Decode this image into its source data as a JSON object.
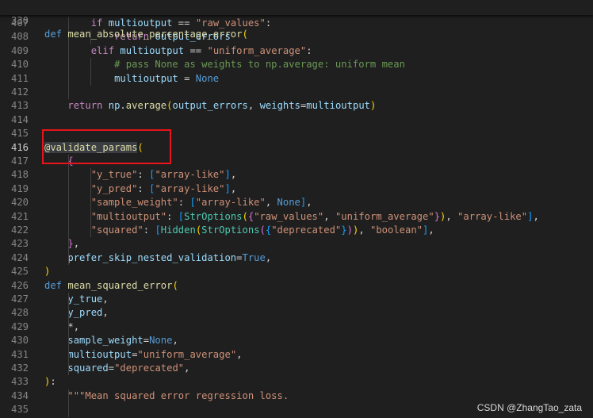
{
  "editor": {
    "sticky": {
      "line_number": "330",
      "tokens": [
        {
          "t": "def",
          "c": "kw"
        },
        {
          "t": " ",
          "c": ""
        },
        {
          "t": "mean_absolute_percentage_error",
          "c": "fn"
        },
        {
          "t": "(",
          "c": "b1"
        }
      ]
    },
    "lines": [
      {
        "n": "407",
        "tokens": [
          {
            "t": "        ",
            "c": ""
          },
          {
            "t": "if",
            "c": "ctl"
          },
          {
            "t": " ",
            "c": ""
          },
          {
            "t": "multioutput",
            "c": "var"
          },
          {
            "t": " == ",
            "c": "plain"
          },
          {
            "t": "\"raw_values\"",
            "c": "str"
          },
          {
            "t": ":",
            "c": "plain"
          }
        ]
      },
      {
        "n": "408",
        "tokens": [
          {
            "t": "            ",
            "c": ""
          },
          {
            "t": "return",
            "c": "ctl"
          },
          {
            "t": " ",
            "c": ""
          },
          {
            "t": "output_errors",
            "c": "var"
          }
        ]
      },
      {
        "n": "409",
        "tokens": [
          {
            "t": "        ",
            "c": ""
          },
          {
            "t": "elif",
            "c": "ctl"
          },
          {
            "t": " ",
            "c": ""
          },
          {
            "t": "multioutput",
            "c": "var"
          },
          {
            "t": " == ",
            "c": "plain"
          },
          {
            "t": "\"uniform_average\"",
            "c": "str"
          },
          {
            "t": ":",
            "c": "plain"
          }
        ]
      },
      {
        "n": "410",
        "tokens": [
          {
            "t": "            ",
            "c": ""
          },
          {
            "t": "# pass None as weights to np.average: uniform mean",
            "c": "cmt"
          }
        ]
      },
      {
        "n": "411",
        "tokens": [
          {
            "t": "            ",
            "c": ""
          },
          {
            "t": "multioutput",
            "c": "var"
          },
          {
            "t": " = ",
            "c": "plain"
          },
          {
            "t": "None",
            "c": "kw"
          }
        ]
      },
      {
        "n": "412",
        "tokens": []
      },
      {
        "n": "413",
        "tokens": [
          {
            "t": "    ",
            "c": ""
          },
          {
            "t": "return",
            "c": "ctl"
          },
          {
            "t": " ",
            "c": ""
          },
          {
            "t": "np",
            "c": "var"
          },
          {
            "t": ".",
            "c": "plain"
          },
          {
            "t": "average",
            "c": "fn"
          },
          {
            "t": "(",
            "c": "b1"
          },
          {
            "t": "output_errors",
            "c": "var"
          },
          {
            "t": ", ",
            "c": "plain"
          },
          {
            "t": "weights",
            "c": "var"
          },
          {
            "t": "=",
            "c": "plain"
          },
          {
            "t": "multioutput",
            "c": "var"
          },
          {
            "t": ")",
            "c": "b1"
          }
        ]
      },
      {
        "n": "414",
        "tokens": []
      },
      {
        "n": "415",
        "tokens": []
      },
      {
        "n": "416",
        "active": true,
        "tokens": [
          {
            "t": "@",
            "c": "fn hl"
          },
          {
            "t": "validate_params",
            "c": "fn hl"
          },
          {
            "t": "(",
            "c": "b1"
          }
        ]
      },
      {
        "n": "417",
        "tokens": [
          {
            "t": "    ",
            "c": ""
          },
          {
            "t": "{",
            "c": "b2"
          }
        ]
      },
      {
        "n": "418",
        "tokens": [
          {
            "t": "        ",
            "c": ""
          },
          {
            "t": "\"y_true\"",
            "c": "str"
          },
          {
            "t": ": ",
            "c": "plain"
          },
          {
            "t": "[",
            "c": "b3"
          },
          {
            "t": "\"array-like\"",
            "c": "str"
          },
          {
            "t": "]",
            "c": "b3"
          },
          {
            "t": ",",
            "c": "plain"
          }
        ]
      },
      {
        "n": "419",
        "tokens": [
          {
            "t": "        ",
            "c": ""
          },
          {
            "t": "\"y_pred\"",
            "c": "str"
          },
          {
            "t": ": ",
            "c": "plain"
          },
          {
            "t": "[",
            "c": "b3"
          },
          {
            "t": "\"array-like\"",
            "c": "str"
          },
          {
            "t": "]",
            "c": "b3"
          },
          {
            "t": ",",
            "c": "plain"
          }
        ]
      },
      {
        "n": "420",
        "tokens": [
          {
            "t": "        ",
            "c": ""
          },
          {
            "t": "\"sample_weight\"",
            "c": "str"
          },
          {
            "t": ": ",
            "c": "plain"
          },
          {
            "t": "[",
            "c": "b3"
          },
          {
            "t": "\"array-like\"",
            "c": "str"
          },
          {
            "t": ", ",
            "c": "plain"
          },
          {
            "t": "None",
            "c": "kw"
          },
          {
            "t": "]",
            "c": "b3"
          },
          {
            "t": ",",
            "c": "plain"
          }
        ]
      },
      {
        "n": "421",
        "tokens": [
          {
            "t": "        ",
            "c": ""
          },
          {
            "t": "\"multioutput\"",
            "c": "str"
          },
          {
            "t": ": ",
            "c": "plain"
          },
          {
            "t": "[",
            "c": "b3"
          },
          {
            "t": "StrOptions",
            "c": "cls"
          },
          {
            "t": "(",
            "c": "b1"
          },
          {
            "t": "{",
            "c": "b2"
          },
          {
            "t": "\"raw_values\"",
            "c": "str"
          },
          {
            "t": ", ",
            "c": "plain"
          },
          {
            "t": "\"uniform_average\"",
            "c": "str"
          },
          {
            "t": "}",
            "c": "b2"
          },
          {
            "t": ")",
            "c": "b1"
          },
          {
            "t": ", ",
            "c": "plain"
          },
          {
            "t": "\"array-like\"",
            "c": "str"
          },
          {
            "t": "]",
            "c": "b3"
          },
          {
            "t": ",",
            "c": "plain"
          }
        ]
      },
      {
        "n": "422",
        "tokens": [
          {
            "t": "        ",
            "c": ""
          },
          {
            "t": "\"squared\"",
            "c": "str"
          },
          {
            "t": ": ",
            "c": "plain"
          },
          {
            "t": "[",
            "c": "b3"
          },
          {
            "t": "Hidden",
            "c": "cls"
          },
          {
            "t": "(",
            "c": "b1"
          },
          {
            "t": "StrOptions",
            "c": "cls"
          },
          {
            "t": "(",
            "c": "b2"
          },
          {
            "t": "{",
            "c": "b3"
          },
          {
            "t": "\"deprecated\"",
            "c": "str"
          },
          {
            "t": "}",
            "c": "b3"
          },
          {
            "t": ")",
            "c": "b2"
          },
          {
            "t": ")",
            "c": "b1"
          },
          {
            "t": ", ",
            "c": "plain"
          },
          {
            "t": "\"boolean\"",
            "c": "str"
          },
          {
            "t": "]",
            "c": "b3"
          },
          {
            "t": ",",
            "c": "plain"
          }
        ]
      },
      {
        "n": "423",
        "tokens": [
          {
            "t": "    ",
            "c": ""
          },
          {
            "t": "}",
            "c": "b2"
          },
          {
            "t": ",",
            "c": "plain"
          }
        ]
      },
      {
        "n": "424",
        "tokens": [
          {
            "t": "    ",
            "c": ""
          },
          {
            "t": "prefer_skip_nested_validation",
            "c": "var"
          },
          {
            "t": "=",
            "c": "plain"
          },
          {
            "t": "True",
            "c": "kw"
          },
          {
            "t": ",",
            "c": "plain"
          }
        ]
      },
      {
        "n": "425",
        "tokens": [
          {
            "t": ")",
            "c": "b1"
          }
        ]
      },
      {
        "n": "426",
        "tokens": [
          {
            "t": "def",
            "c": "kw"
          },
          {
            "t": " ",
            "c": ""
          },
          {
            "t": "mean_squared_error",
            "c": "fn"
          },
          {
            "t": "(",
            "c": "b1"
          }
        ]
      },
      {
        "n": "427",
        "tokens": [
          {
            "t": "    ",
            "c": ""
          },
          {
            "t": "y_true",
            "c": "var"
          },
          {
            "t": ",",
            "c": "plain"
          }
        ]
      },
      {
        "n": "428",
        "tokens": [
          {
            "t": "    ",
            "c": ""
          },
          {
            "t": "y_pred",
            "c": "var"
          },
          {
            "t": ",",
            "c": "plain"
          }
        ]
      },
      {
        "n": "429",
        "tokens": [
          {
            "t": "    ",
            "c": ""
          },
          {
            "t": "*",
            "c": "plain"
          },
          {
            "t": ",",
            "c": "plain"
          }
        ]
      },
      {
        "n": "430",
        "tokens": [
          {
            "t": "    ",
            "c": ""
          },
          {
            "t": "sample_weight",
            "c": "var"
          },
          {
            "t": "=",
            "c": "plain"
          },
          {
            "t": "None",
            "c": "kw"
          },
          {
            "t": ",",
            "c": "plain"
          }
        ]
      },
      {
        "n": "431",
        "tokens": [
          {
            "t": "    ",
            "c": ""
          },
          {
            "t": "multioutput",
            "c": "var"
          },
          {
            "t": "=",
            "c": "plain"
          },
          {
            "t": "\"uniform_average\"",
            "c": "str"
          },
          {
            "t": ",",
            "c": "plain"
          }
        ]
      },
      {
        "n": "432",
        "tokens": [
          {
            "t": "    ",
            "c": ""
          },
          {
            "t": "squared",
            "c": "var"
          },
          {
            "t": "=",
            "c": "plain"
          },
          {
            "t": "\"deprecated\"",
            "c": "str"
          },
          {
            "t": ",",
            "c": "plain"
          }
        ]
      },
      {
        "n": "433",
        "tokens": [
          {
            "t": ")",
            "c": "b1"
          },
          {
            "t": ":",
            "c": "plain"
          }
        ]
      },
      {
        "n": "434",
        "tokens": [
          {
            "t": "    ",
            "c": ""
          },
          {
            "t": "\"\"\"Mean squared error regression loss.",
            "c": "str"
          }
        ]
      },
      {
        "n": "435",
        "tokens": []
      }
    ]
  },
  "annotation": {
    "label": "highlight-box",
    "color": "#e8141b"
  },
  "watermark": "CSDN @ZhangTao_zata",
  "colors": {
    "background": "#1f1f1f",
    "keyword": "#569cd6",
    "control": "#c586c0",
    "function": "#dcdcaa",
    "variable": "#9cdcfe",
    "string": "#ce9178",
    "comment": "#6a9955",
    "class": "#4ec9b0"
  }
}
